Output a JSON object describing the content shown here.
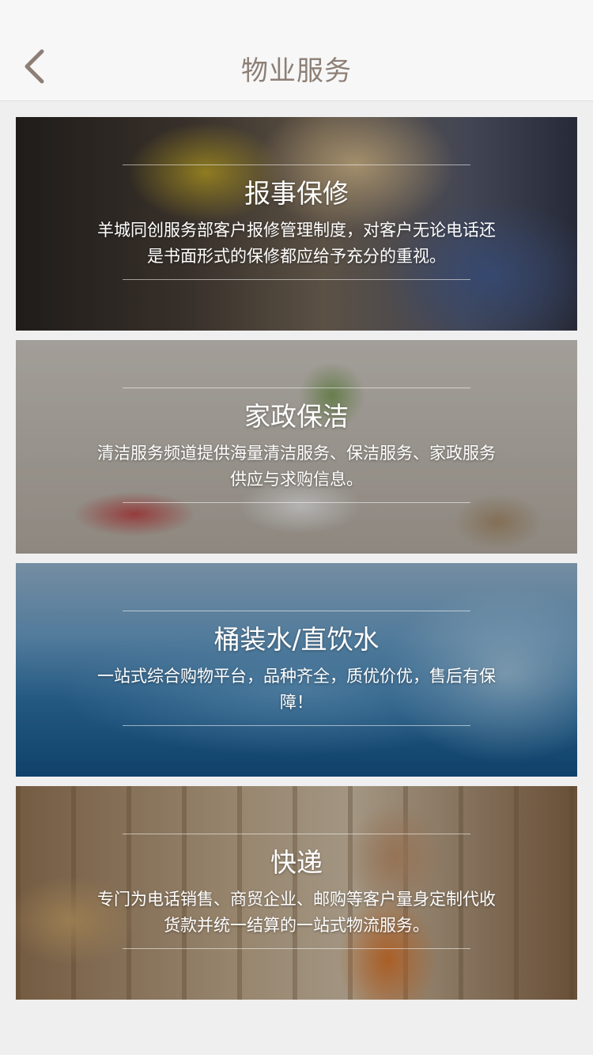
{
  "nav": {
    "title": "物业服务",
    "back_icon": "chevron-left-icon"
  },
  "cards": [
    {
      "title": "报事保修",
      "desc": "羊城同创服务部客户报修管理制度，对客户无论电话还是书面形式的保修都应给予充分的重视。",
      "image": "repair-worker-image"
    },
    {
      "title": "家政保洁",
      "desc": "清洁服务频道提供海量清洁服务、保洁服务、家政服务供应与求购信息。",
      "image": "bathroom-towels-image"
    },
    {
      "title": "桶装水/直饮水",
      "desc": "一站式综合购物平台，品种齐全，质优价优，售后有保障！",
      "image": "water-splash-image"
    },
    {
      "title": "快递",
      "desc": "专门为电话销售、商贸企业、邮购等客户量身定制代收货款并统一结算的一站式物流服务。",
      "image": "warehouse-courier-image"
    }
  ],
  "colors": {
    "nav_bg": "#f7f7f7",
    "nav_title": "#8d7f76",
    "page_bg": "#efeff0"
  }
}
